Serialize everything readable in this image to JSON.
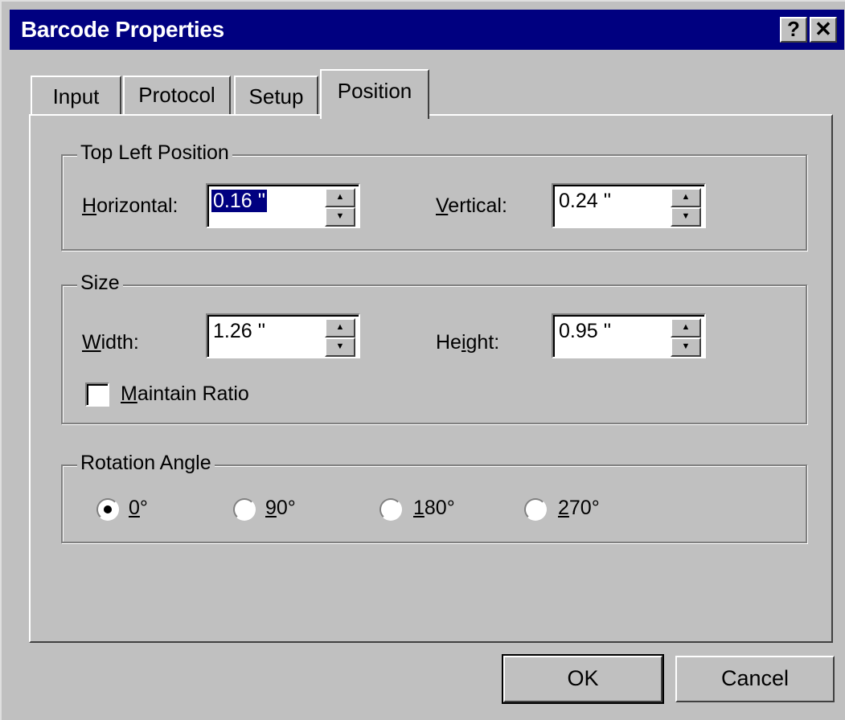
{
  "window": {
    "title": "Barcode Properties",
    "help_glyph": "?",
    "close_glyph": "✕"
  },
  "tabs": [
    {
      "label": "Input",
      "active": false
    },
    {
      "label": "Protocol",
      "active": false
    },
    {
      "label": "Setup",
      "active": false
    },
    {
      "label": "Position",
      "active": true
    }
  ],
  "top_left_position": {
    "legend": "Top Left Position",
    "horizontal": {
      "mnemonic": "H",
      "rest": "orizontal:",
      "value": "0.16 ''"
    },
    "vertical": {
      "mnemonic": "V",
      "rest": "ertical:",
      "value": "0.24 ''"
    }
  },
  "size": {
    "legend": "Size",
    "width": {
      "mnemonic": "W",
      "rest": "idth:",
      "value": "1.26 ''"
    },
    "height": {
      "pre": "He",
      "mnemonic": "i",
      "rest": "ght:",
      "value": "0.95 ''"
    },
    "maintain_ratio": {
      "mnemonic": "M",
      "rest": "aintain Ratio",
      "checked": false
    }
  },
  "rotation": {
    "legend": "Rotation Angle",
    "options": [
      {
        "mnemonic": "0",
        "rest": "°",
        "selected": true
      },
      {
        "mnemonic": "9",
        "rest": "0°",
        "selected": false
      },
      {
        "mnemonic": "1",
        "rest": "80°",
        "selected": false
      },
      {
        "mnemonic": "2",
        "rest": "70°",
        "selected": false
      }
    ]
  },
  "buttons": {
    "ok": "OK",
    "cancel": "Cancel"
  },
  "spin_glyphs": {
    "up": "▲",
    "down": "▼"
  }
}
